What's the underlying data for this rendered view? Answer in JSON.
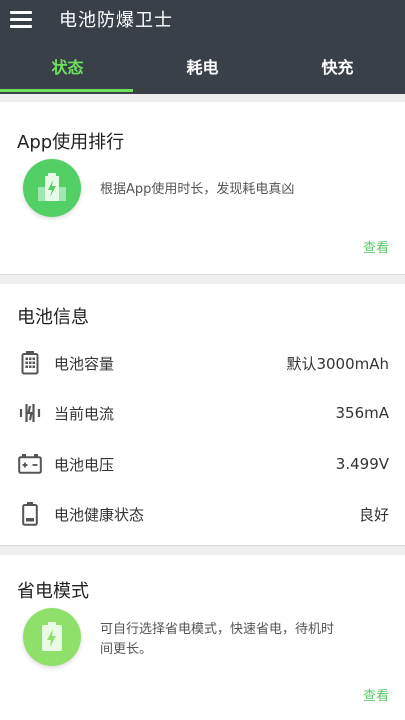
{
  "header": {
    "title": "电池防爆卫士",
    "tabs": [
      {
        "label": "状态"
      },
      {
        "label": "耗电"
      },
      {
        "label": "快充"
      }
    ],
    "active_tab": 0
  },
  "app_usage": {
    "title": "App使用排行",
    "description": "根据App使用时长，发现耗电真凶",
    "link": "查看"
  },
  "battery_info": {
    "title": "电池信息",
    "rows": [
      {
        "icon": "battery-capacity-icon",
        "label": "电池容量",
        "value": "默认3000mAh"
      },
      {
        "icon": "current-icon",
        "label": "当前电流",
        "value": "356mA"
      },
      {
        "icon": "voltage-icon",
        "label": "电池电压",
        "value": "3.499V"
      },
      {
        "icon": "battery-health-icon",
        "label": "电池健康状态",
        "value": "良好"
      }
    ]
  },
  "power_saving": {
    "title": "省电模式",
    "description_line1": "可自行选择省电模式，快速省电，待机时",
    "description_line2": "间更长。",
    "link": "查看"
  },
  "colors": {
    "header_bg": "#394048",
    "accent_green": "#6ee05c",
    "link_green": "#5dc86b"
  }
}
